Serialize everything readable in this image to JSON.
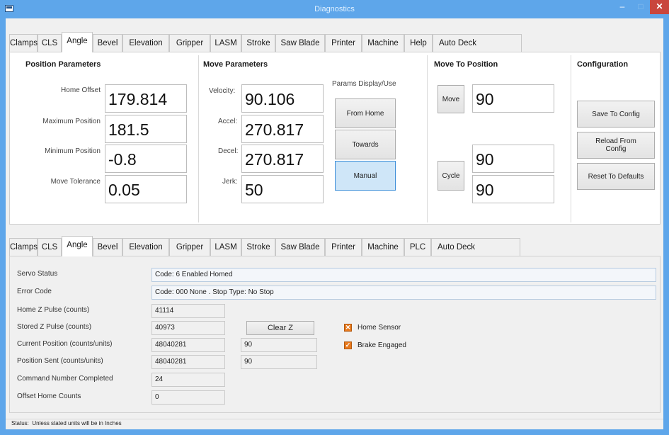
{
  "window": {
    "title": "Diagnostics",
    "minimize": "–",
    "maximize": "□",
    "close": "✕"
  },
  "top_tabs": [
    "Clamps",
    "CLS",
    "Angle",
    "Bevel",
    "Elevation",
    "Gripper",
    "LASM",
    "Stroke",
    "Saw Blade",
    "Printer",
    "Machine",
    "Help",
    "Auto Deck"
  ],
  "top_active_tab": "Angle",
  "position_parameters": {
    "title": "Position Parameters",
    "home_offset_label": "Home Offset",
    "home_offset": "179.814",
    "maximum_position_label": "Maximum Position",
    "maximum_position": "181.5",
    "minimum_position_label": "Minimum Position",
    "minimum_position": "-0.8",
    "move_tolerance_label": "Move Tolerance",
    "move_tolerance": "0.05"
  },
  "move_parameters": {
    "title": "Move Parameters",
    "velocity_label": "Velocity:",
    "velocity": "90.106",
    "accel_label": "Accel:",
    "accel": "270.817",
    "decel_label": "Decel:",
    "decel": "270.817",
    "jerk_label": "Jerk:",
    "jerk": "50",
    "params_display_label": "Params Display/Use",
    "from_home_button": "From Home",
    "towards_button": "Towards",
    "manual_button": "Manual",
    "selected_mode": "Manual"
  },
  "move_to_position": {
    "title": "Move To Position",
    "move_button": "Move",
    "move_value": "90",
    "cycle_button": "Cycle",
    "cycle_value_1": "90",
    "cycle_value_2": "90"
  },
  "configuration": {
    "title": "Configuration",
    "save_button": "Save To Config",
    "reload_button": "Reload From Config",
    "reset_button": "Reset To Defaults"
  },
  "bottom_tabs": [
    "Clamps",
    "CLS",
    "Angle",
    "Bevel",
    "Elevation",
    "Gripper",
    "LASM",
    "Stroke",
    "Saw Blade",
    "Printer",
    "Machine",
    "PLC",
    "Auto Deck"
  ],
  "bottom_active_tab": "Angle",
  "status": {
    "servo_status_label": "Servo Status",
    "servo_status": "Code: 6 Enabled Homed",
    "error_code_label": "Error Code",
    "error_code": "Code: 000 None . Stop Type: No Stop",
    "home_z_pulse_label": "Home Z Pulse (counts)",
    "home_z_pulse": "41114",
    "stored_z_pulse_label": "Stored Z Pulse (counts)",
    "stored_z_pulse": "40973",
    "current_position_label": "Current Position (counts/units)",
    "current_position_counts": "48040281",
    "current_position_units": "90",
    "position_sent_label": "Position Sent (counts/units)",
    "position_sent_counts": "48040281",
    "position_sent_units": "90",
    "command_number_label": "Command Number Completed",
    "command_number": "24",
    "offset_home_counts_label": "Offset Home Counts",
    "offset_home_counts": "0",
    "clear_z_button": "Clear Z",
    "home_sensor_label": "Home Sensor",
    "home_sensor_checked": true,
    "brake_engaged_label": "Brake Engaged",
    "brake_engaged_checked": true
  },
  "statusbar": {
    "label": "Status:",
    "message": "Unless stated units will be in Inches"
  },
  "colors": {
    "title_bar": "#5ea6ea",
    "close_button": "#c9463d",
    "selected_button": "#cfe6f8",
    "checkbox": "#e87a1e"
  }
}
